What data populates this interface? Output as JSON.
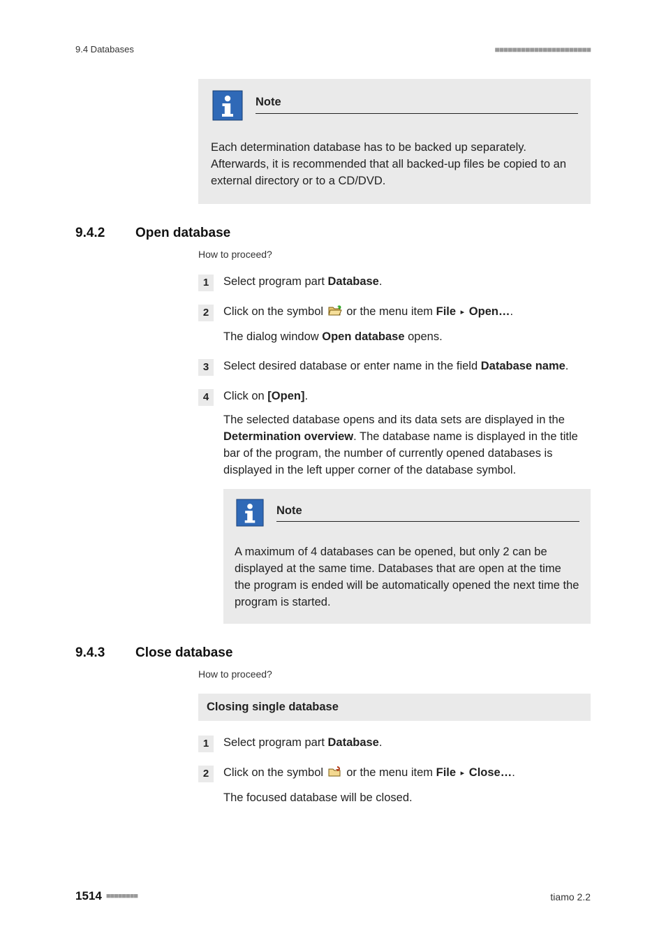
{
  "header": {
    "left": "9.4 Databases"
  },
  "note1": {
    "title": "Note",
    "body": "Each determination database has to be backed up separately. Afterwards, it is recommended that all backed-up files be copied to an external directory or to a CD/DVD."
  },
  "sec942": {
    "num": "9.4.2",
    "title": "Open database",
    "proceed": "How to proceed?",
    "steps": {
      "s1": {
        "n": "1",
        "pre": "Select program part ",
        "bold": "Database",
        "post": "."
      },
      "s2": {
        "n": "2",
        "pre": "Click on the symbol ",
        "mid": " or the menu item ",
        "file": "File",
        "open": "Open…",
        "post": ".",
        "result_a": "The dialog window ",
        "result_b": "Open database",
        "result_c": " opens."
      },
      "s3": {
        "n": "3",
        "pre": "Select desired database or enter name in the field ",
        "bold": "Database name",
        "post": "."
      },
      "s4": {
        "n": "4",
        "pre": "Click on ",
        "bold": "[Open]",
        "post": ".",
        "para_a": "The selected database opens and its data sets are displayed in the ",
        "para_b": "Determination overview",
        "para_c": ". The database name is displayed in the title bar of the program, the number of currently opened databases is displayed in the left upper corner of the database symbol."
      }
    },
    "note": {
      "title": "Note",
      "body": "A maximum of 4 databases can be opened, but only 2 can be displayed at the same time. Databases that are open at the time the program is ended will be automatically opened the next time the program is started."
    }
  },
  "sec943": {
    "num": "9.4.3",
    "title": "Close database",
    "proceed": "How to proceed?",
    "subtitle": "Closing single database",
    "steps": {
      "s1": {
        "n": "1",
        "pre": "Select program part ",
        "bold": "Database",
        "post": "."
      },
      "s2": {
        "n": "2",
        "pre": "Click on the symbol ",
        "mid": " or the menu item ",
        "file": "File",
        "close": "Close…",
        "post": ".",
        "result": "The focused database will be closed."
      }
    }
  },
  "footer": {
    "page": "1514",
    "right": "tiamo 2.2"
  }
}
